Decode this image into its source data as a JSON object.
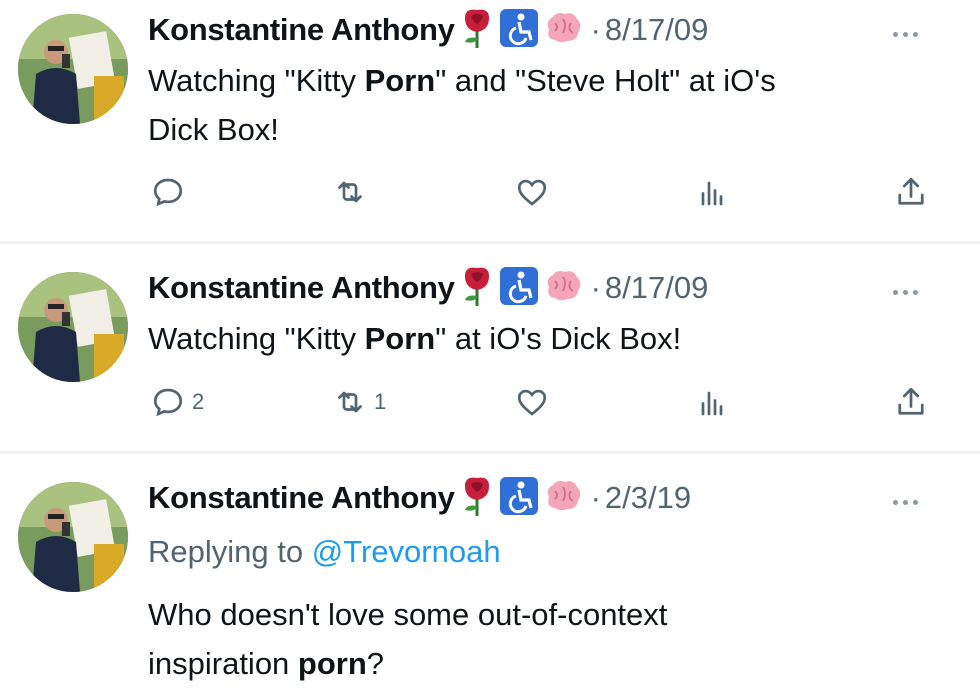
{
  "tweets": [
    {
      "author": "Konstantine Anthony",
      "badges": [
        "rose-emoji",
        "wheelchair-symbol",
        "brain-emoji"
      ],
      "separator": "·",
      "date": "8/17/09",
      "text_parts": [
        "Watching \"Kitty ",
        "Porn",
        "\" and \"Steve Holt\" at iO's",
        "Dick Box!"
      ],
      "reply_count": "",
      "retweet_count": ""
    },
    {
      "author": "Konstantine Anthony",
      "badges": [
        "rose-emoji",
        "wheelchair-symbol",
        "brain-emoji"
      ],
      "separator": "·",
      "date": "8/17/09",
      "text_parts": [
        "Watching \"Kitty ",
        "Porn",
        "\" at iO's Dick Box!"
      ],
      "reply_count": "2",
      "retweet_count": "1"
    },
    {
      "author": "Konstantine Anthony",
      "badges": [
        "rose-emoji",
        "wheelchair-symbol",
        "brain-emoji"
      ],
      "separator": "·",
      "date": "2/3/19",
      "replying_prefix": "Replying to ",
      "replying_handle": "@Trevornoah",
      "text_parts": [
        "Who doesn't love some out-of-context",
        "inspiration ",
        "porn",
        "?"
      ]
    }
  ],
  "colors": {
    "text": "#0f1419",
    "muted": "#536471",
    "link": "#1d9bf0",
    "wheelchair_badge": "#2f6fd6",
    "rose": "#c81e3a",
    "brain": "#f4a6b8"
  },
  "icons": [
    "reply-icon",
    "retweet-icon",
    "like-icon",
    "views-icon",
    "share-icon",
    "more-icon"
  ]
}
